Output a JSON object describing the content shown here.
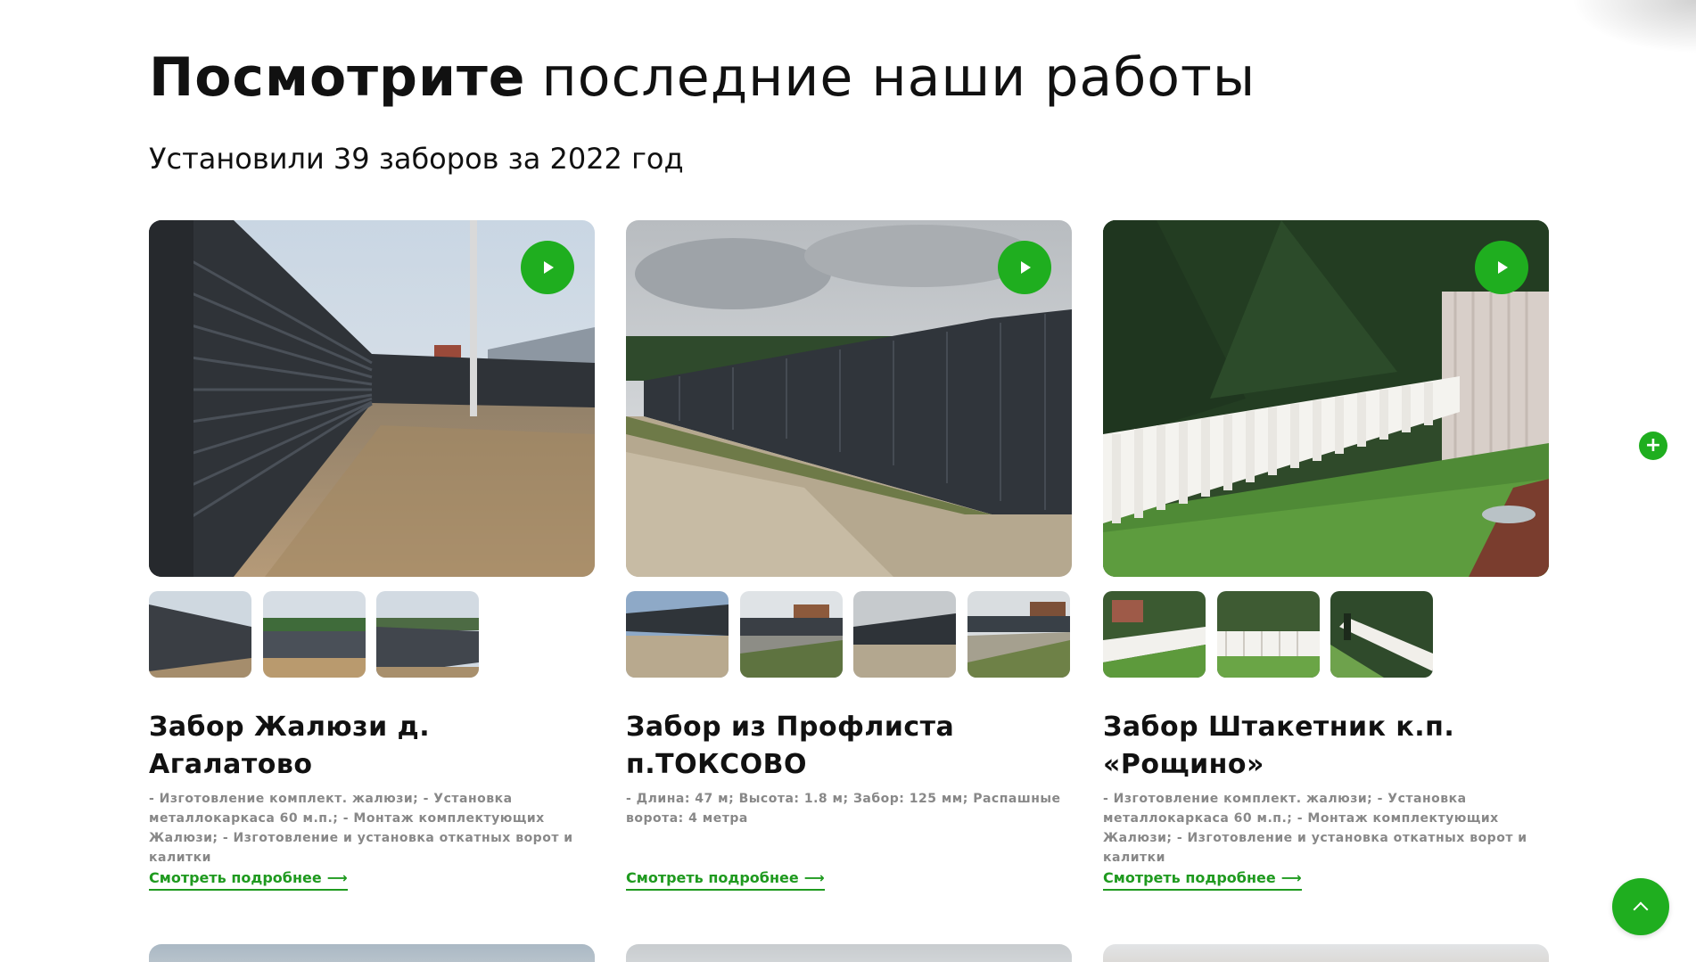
{
  "header": {
    "title_bold": "Посмотрите",
    "title_rest": "последние наши работы",
    "subtitle": "Установили 39 заборов за 2022 год"
  },
  "cards": [
    {
      "title": "Забор Жалюзи д. Агалатово",
      "description": "- Изготовление комплект. жалюзи; - Установка металлокаркаса 60 м.п.; - Монтаж комплектующих Жалюзи; - Изготовление и установка откатных ворот и калитки",
      "link": "Смотреть подробнее",
      "thumb_count": 3
    },
    {
      "title": "Забор из Профлиста п.ТОКСОВО",
      "description": "- Длина: 47 м; Высота: 1.8 м; Забор: 125 мм; Распашные ворота: 4 метра",
      "link": "Смотреть подробнее",
      "thumb_count": 4
    },
    {
      "title": "Забор Штакетник к.п. «Рощино»",
      "description": "- Изготовление комплект. жалюзи; - Установка металлокаркаса 60 м.п.; - Монтаж комплектующих Жалюзи; - Изготовление и установка откатных ворот и калитки",
      "link": "Смотреть подробнее",
      "thumb_count": 3
    }
  ],
  "icons": {
    "play": "play-icon",
    "plus": "plus-icon",
    "arrow": "arrow-right-icon",
    "scroll_top": "chevron-up-icon"
  },
  "colors": {
    "accent": "#1fae1f",
    "link": "#1f9a1f",
    "text": "#111111",
    "muted": "#888888"
  }
}
